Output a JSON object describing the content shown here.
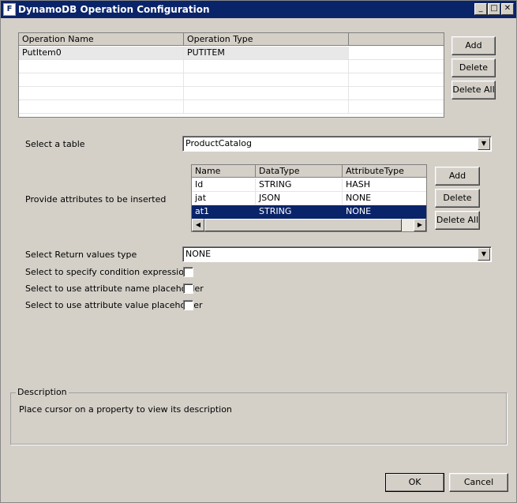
{
  "window": {
    "title": "DynamoDB Operation Configuration",
    "icon": "app-icon"
  },
  "operations": {
    "columns": [
      "Operation Name",
      "Operation Type"
    ],
    "rows": [
      [
        "PutItem0",
        "PUTITEM"
      ]
    ],
    "add_label": "Add",
    "delete_label": "Delete",
    "delete_all_label": "Delete All"
  },
  "table": {
    "label": "Select a table",
    "value": "ProductCatalog"
  },
  "attributes": {
    "label": "Provide attributes to be inserted",
    "columns": [
      "Name",
      "DataType",
      "AttributeType"
    ],
    "rows": [
      [
        "Id",
        "STRING",
        "HASH"
      ],
      [
        "jat",
        "JSON",
        "NONE"
      ],
      [
        "at1",
        "STRING",
        "NONE"
      ]
    ],
    "add_label": "Add",
    "delete_label": "Delete",
    "delete_all_label": "Delete All"
  },
  "return_values": {
    "label": "Select Return values type",
    "value": "NONE"
  },
  "options": {
    "condition_label": "Select to specify condition expression",
    "name_placeholder_label": "Select to use attribute name placeholder",
    "value_placeholder_label": "Select to use attribute value placeholder"
  },
  "description": {
    "legend": "Description",
    "text": "Place cursor on a property to view its description"
  },
  "footer": {
    "ok_label": "OK",
    "cancel_label": "Cancel"
  }
}
